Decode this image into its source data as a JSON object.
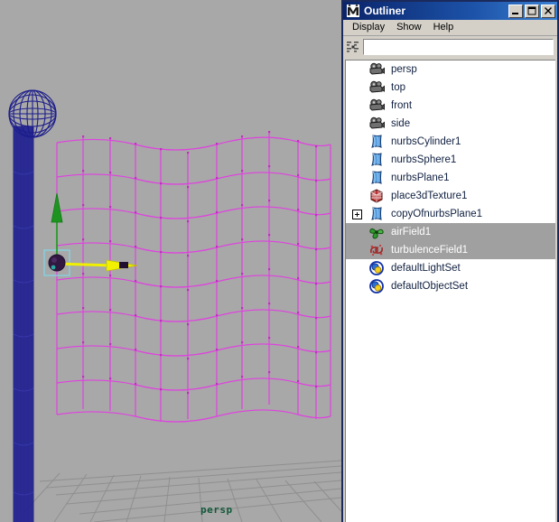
{
  "viewport": {
    "name": "perspective-viewport",
    "camera_label": "persp",
    "background_color": "#a8a8a8",
    "grid_color": "#909090",
    "objects": {
      "pole_color": "#1c1c8c",
      "flag_color": "#e040e0",
      "flag_cv_color": "#c030c0",
      "sphere_color": "#1c1c8c",
      "manip_y_color": "#00a000",
      "manip_x_color": "#f0f000",
      "manip_center_color": "#301840",
      "selection_box_color": "#80d8e8"
    }
  },
  "outliner": {
    "title": "Outliner",
    "title_icon": "maya-logo-icon",
    "window_buttons": [
      {
        "name": "minimize-button",
        "glyph": "minimize-icon"
      },
      {
        "name": "maximize-button",
        "glyph": "maximize-icon"
      },
      {
        "name": "close-button",
        "glyph": "close-icon"
      }
    ],
    "menus": [
      {
        "label": "Display"
      },
      {
        "label": "Show"
      },
      {
        "label": "Help"
      }
    ],
    "toolbar": {
      "sort_icon": "outliner-sort-icon",
      "filter_value": "",
      "filter_placeholder": ""
    },
    "items": [
      {
        "label": "persp",
        "icon": "camera-icon",
        "selected": false,
        "expandable": false
      },
      {
        "label": "top",
        "icon": "camera-icon",
        "selected": false,
        "expandable": false
      },
      {
        "label": "front",
        "icon": "camera-icon",
        "selected": false,
        "expandable": false
      },
      {
        "label": "side",
        "icon": "camera-icon",
        "selected": false,
        "expandable": false
      },
      {
        "label": "nurbsCylinder1",
        "icon": "nurbs-surface-icon",
        "selected": false,
        "expandable": false
      },
      {
        "label": "nurbsSphere1",
        "icon": "nurbs-surface-icon",
        "selected": false,
        "expandable": false
      },
      {
        "label": "nurbsPlane1",
        "icon": "nurbs-surface-icon",
        "selected": false,
        "expandable": false
      },
      {
        "label": "place3dTexture1",
        "icon": "place3d-texture-icon",
        "selected": false,
        "expandable": false
      },
      {
        "label": "copyOfnurbsPlane1",
        "icon": "nurbs-surface-icon",
        "selected": false,
        "expandable": true
      },
      {
        "label": "airField1",
        "icon": "air-field-icon",
        "selected": true,
        "expandable": false
      },
      {
        "label": "turbulenceField1",
        "icon": "turbulence-field-icon",
        "selected": true,
        "expandable": false
      },
      {
        "label": "defaultLightSet",
        "icon": "set-icon",
        "selected": false,
        "expandable": false
      },
      {
        "label": "defaultObjectSet",
        "icon": "set-icon",
        "selected": false,
        "expandable": false
      }
    ],
    "colors": {
      "titlebar_start": "#0a246a",
      "titlebar_end": "#3a80d2",
      "chrome": "#d4d0c8",
      "border": "#1b2a5c",
      "selection": "#a0a0a0",
      "label": "#102040"
    }
  }
}
